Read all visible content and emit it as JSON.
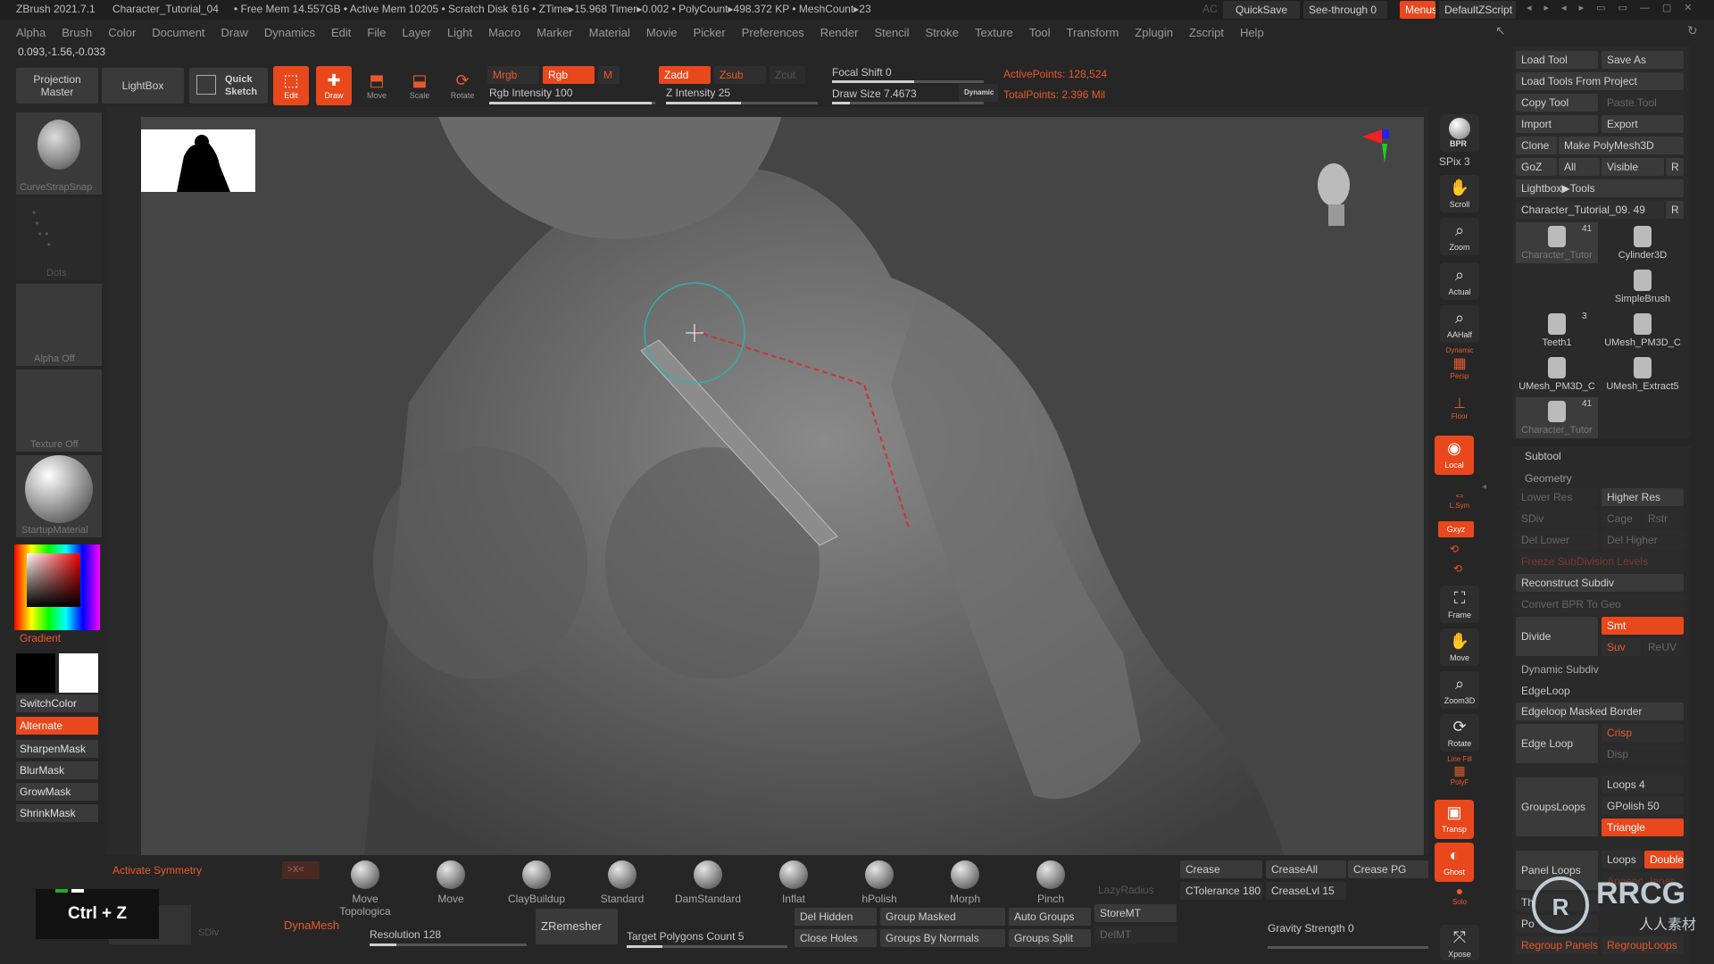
{
  "titlebar": {
    "app": "ZBrush 2021.7.1",
    "file": "Character_Tutorial_04",
    "stats": "• Free Mem 14.557GB • Active Mem 10205 • Scratch Disk 616 • ZTime▸15.968 Timer▸0.002 • PolyCount▸498.372 KP • MeshCount▸23",
    "ac": "AC",
    "quicksave": "QuickSave",
    "see_through": "See-through 0",
    "menus": "Menus",
    "default_zscript": "DefaultZScript"
  },
  "menubar": [
    "Alpha",
    "Brush",
    "Color",
    "Document",
    "Draw",
    "Dynamics",
    "Edit",
    "File",
    "Layer",
    "Light",
    "Macro",
    "Marker",
    "Material",
    "Movie",
    "Picker",
    "Preferences",
    "Render",
    "Stencil",
    "Stroke",
    "Texture",
    "Tool",
    "Transform",
    "Zplugin",
    "Zscript",
    "Help"
  ],
  "coords": "0.093,-1.56,-0.033",
  "toolbar": {
    "projection_master": "Projection Master",
    "lightbox": "LightBox",
    "quick_sketch": "Quick Sketch",
    "edit": "Edit",
    "draw": "Draw",
    "move": "Move",
    "scale": "Scale",
    "rotate": "Rotate",
    "mrgb": "Mrgb",
    "rgb": "Rgb",
    "m": "M",
    "rgb_intensity": "Rgb Intensity 100",
    "zadd": "Zadd",
    "zsub": "Zsub",
    "zcut": "Zcut",
    "z_intensity": "Z Intensity 25",
    "focal_shift": "Focal Shift 0",
    "draw_size": "Draw Size 7.4673",
    "dynamic": "Dynamic",
    "active_points": "ActivePoints: 128,524",
    "total_points": "TotalPoints: 2.396 Mil"
  },
  "left": {
    "brush_name": "CurveStrapSnap",
    "stroke_name": "Dots",
    "alpha": "Alpha Off",
    "texture": "Texture Off",
    "material": "StartupMaterial",
    "gradient": "Gradient",
    "switch_color": "SwitchColor",
    "alternate": "Alternate",
    "sharpen_mask": "SharpenMask",
    "blur_mask": "BlurMask",
    "grow_mask": "GrowMask",
    "shrink_mask": "ShrinkMask"
  },
  "right_nav": {
    "bpr": "BPR",
    "spix": "SPix 3",
    "scroll": "Scroll",
    "zoom": "Zoom",
    "actual": "Actual",
    "aahalf": "AAHalf",
    "dynamic": "Dynamic",
    "persp": "Persp",
    "floor": "Floor",
    "local": "Local",
    "lsym": "L.Sym",
    "xyz": "Gxyz",
    "frame": "Frame",
    "move": "Move",
    "zoom3d": "Zoom3D",
    "rotate": "Rotate",
    "line_fill": "Line Fill",
    "polyf": "PolyF",
    "transp": "Transp",
    "ghost": "Ghost",
    "solo": "Solo",
    "xpose": "Xpose"
  },
  "tool_panel": {
    "load_tool": "Load Tool",
    "save_as": "Save As",
    "load_from_project": "Load Tools From Project",
    "copy_tool": "Copy Tool",
    "paste_tool": "Paste Tool",
    "import": "Import",
    "export": "Export",
    "clone": "Clone",
    "make_polymesh": "Make PolyMesh3D",
    "goz": "GoZ",
    "all": "All",
    "visible": "Visible",
    "r": "R",
    "lightbox_tools": "Lightbox▶Tools",
    "current_tool": "Character_Tutorial_09. 49",
    "thumbs": [
      {
        "name": "Character_Tutor",
        "count": "41"
      },
      {
        "name": "Cylinder3D",
        "count": ""
      },
      {
        "name": "SimpleBrush",
        "count": ""
      },
      {
        "name": "Teeth1",
        "count": "3"
      },
      {
        "name": "UMesh_PM3D_C",
        "count": ""
      },
      {
        "name": "UMesh_PM3D_C",
        "count": ""
      },
      {
        "name": "UMesh_Extract5",
        "count": ""
      },
      {
        "name": "Character_Tutor",
        "count": "41"
      }
    ]
  },
  "subtool": {
    "subtool": "Subtool",
    "geometry": "Geometry",
    "lower_res": "Lower Res",
    "higher_res": "Higher Res",
    "sdiv": "SDiv",
    "cage": "Cage",
    "rstr": "Rstr",
    "del_lower": "Del Lower",
    "del_higher": "Del Higher",
    "freeze": "Freeze SubDivision Levels",
    "reconstruct": "Reconstruct Subdiv",
    "convert_bpr": "Convert BPR To Geo",
    "divide": "Divide",
    "smt": "Smt",
    "suv": "Suv",
    "reuv": "ReUV",
    "dynamic_subdiv": "Dynamic Subdiv",
    "edgeloop": "EdgeLoop",
    "edgeloop_masked": "Edgeloop Masked Border",
    "edge_loop": "Edge Loop",
    "crisp": "Crisp",
    "disp": "Disp",
    "groups_loops": "GroupsLoops",
    "loops": "Loops 4",
    "gpolish": "GPolish 50",
    "triangle": "Triangle",
    "panel_loops": "Panel Loops",
    "loops2": "Loops",
    "double": "Double",
    "append": "Append",
    "inner": "Inner",
    "th": "Th",
    "po": "Po",
    "regroup_panels": "Regroup Panels",
    "regroup_loops": "RegroupLoops"
  },
  "bottom": {
    "activate_symmetry": "Activate Symmetry",
    "x_axis": ">X<",
    "brushes": [
      "Move Topologica",
      "Move",
      "ClayBuildup",
      "Standard",
      "DamStandard",
      "Inflat",
      "hPolish",
      "Morph",
      "Pinch"
    ],
    "lazy_radius": "LazyRadius",
    "crease": "Crease",
    "crease_all": "CreaseAll",
    "crease_pg": "Crease PG",
    "ctolerance": "CTolerance 180",
    "creaselvl": "CreaseLvl 15",
    "dynamesh": "DynaMesh",
    "sdiv": "SDiv",
    "resolution": "Resolution 128",
    "zremesher": "ZRemesher",
    "target_polygons": "Target Polygons Count 5",
    "del_hidden": "Del Hidden",
    "close_holes": "Close Holes",
    "group_masked": "Group Masked",
    "groups_by_normals": "Groups By Normals",
    "auto_groups": "Auto Groups",
    "groups_split": "Groups Split",
    "store_mt": "StoreMT",
    "del_mt": "DelMT",
    "gravity": "Gravity Strength 0"
  },
  "overlay": {
    "shortcut": "Ctrl + Z",
    "watermark_text": "RRCG",
    "watermark_sub": "人人素材"
  },
  "colors": {
    "accent": "#e8481c",
    "panel": "#2a2a2a",
    "viewport": "#404040"
  }
}
